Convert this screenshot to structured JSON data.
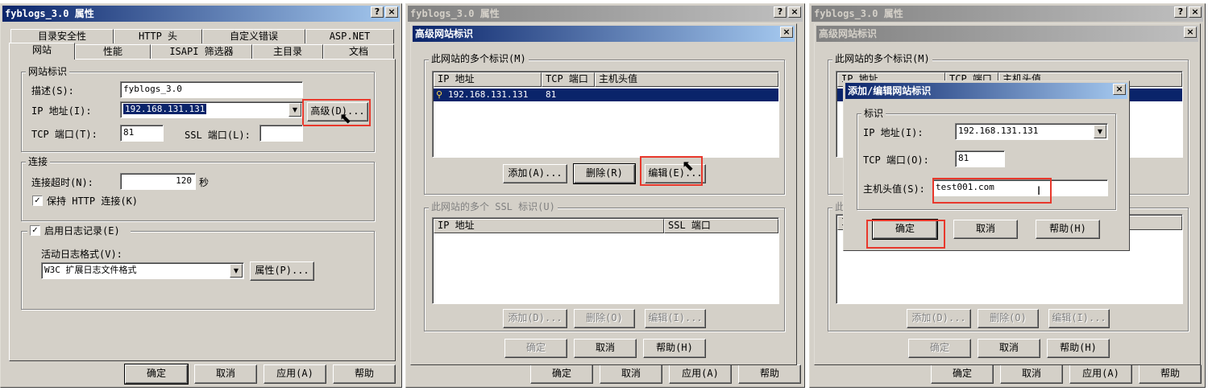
{
  "panel1": {
    "title": "fyblogs_3.0 属性",
    "tabs_row1": [
      "目录安全性",
      "HTTP 头",
      "自定义错误",
      "ASP.NET"
    ],
    "tabs_row2": [
      "网站",
      "性能",
      "ISAPI 筛选器",
      "主目录",
      "文档"
    ],
    "identity_group": "网站标识",
    "desc_label": "描述(S):",
    "desc_value": "fyblogs_3.0",
    "ip_label": "IP 地址(I):",
    "ip_value": "192.168.131.131",
    "advanced_button": "高级(D)...",
    "tcp_label": "TCP 端口(T):",
    "tcp_value": "81",
    "ssl_label": "SSL 端口(L):",
    "ssl_value": "",
    "conn_group": "连接",
    "timeout_label": "连接超时(N):",
    "timeout_value": "120",
    "timeout_unit": "秒",
    "keepalive_label": "保持 HTTP 连接(K)",
    "log_group": "启用日志记录(E)",
    "log_format_label": "活动日志格式(V):",
    "log_format_value": "W3C 扩展日志文件格式",
    "props_button": "属性(P)...",
    "buttons": [
      "确定",
      "取消",
      "应用(A)",
      "帮助"
    ]
  },
  "panel2": {
    "bg_title": "fyblogs_3.0 属性",
    "title": "高级网站标识",
    "ids_group": "此网站的多个标识(M)",
    "col_ip": "IP 地址",
    "col_tcp": "TCP 端口",
    "col_host": "主机头值",
    "row_ip": "192.168.131.131",
    "row_tcp": "81",
    "add_button": "添加(A)...",
    "delete_button": "删除(R)",
    "edit_button": "编辑(E)...",
    "ssl_group": "此网站的多个 SSL 标识(U)",
    "col_ssl_ip": "IP 地址",
    "col_ssl_port": "SSL 端口",
    "ssl_add_button": "添加(D)...",
    "ssl_delete_button": "删除(O)",
    "ssl_edit_button": "编辑(I)...",
    "ok_button": "确定",
    "cancel_button": "取消",
    "help_button": "帮助(H)",
    "bg_buttons": [
      "确定",
      "取消",
      "应用(A)",
      "帮助"
    ]
  },
  "panel3": {
    "bg_title": "fyblogs_3.0 属性",
    "mid_title": "高级网站标识",
    "mid_group": "此网站的多个标识(M)",
    "mid_col_ip": "IP 地址",
    "mid_col_tcp": "TCP 端口",
    "mid_col_host": "主机头值",
    "mid_ssl_group_partial": "此",
    "mid_ssl_col_partial": "I",
    "mid_add": "添加(D)...",
    "mid_delete": "删除(O)",
    "mid_edit": "编辑(I)...",
    "mid_ok": "确定",
    "mid_cancel": "取消",
    "mid_help": "帮助(H)",
    "bg_buttons": [
      "确定",
      "取消",
      "应用(A)",
      "帮助"
    ],
    "title": "添加/编辑网站标识",
    "group": "标识",
    "ip_label": "IP 地址(I):",
    "ip_value": "192.168.131.131",
    "tcp_label": "TCP 端口(O):",
    "tcp_value": "81",
    "host_label": "主机头值(S):",
    "host_value": "test001.com",
    "ok_button": "确定",
    "cancel_button": "取消",
    "help_button": "帮助(H)"
  },
  "colors": {
    "highlight": "#e8382c",
    "title_active": "#0a246a",
    "dialog_bg": "#d4d0c8"
  }
}
